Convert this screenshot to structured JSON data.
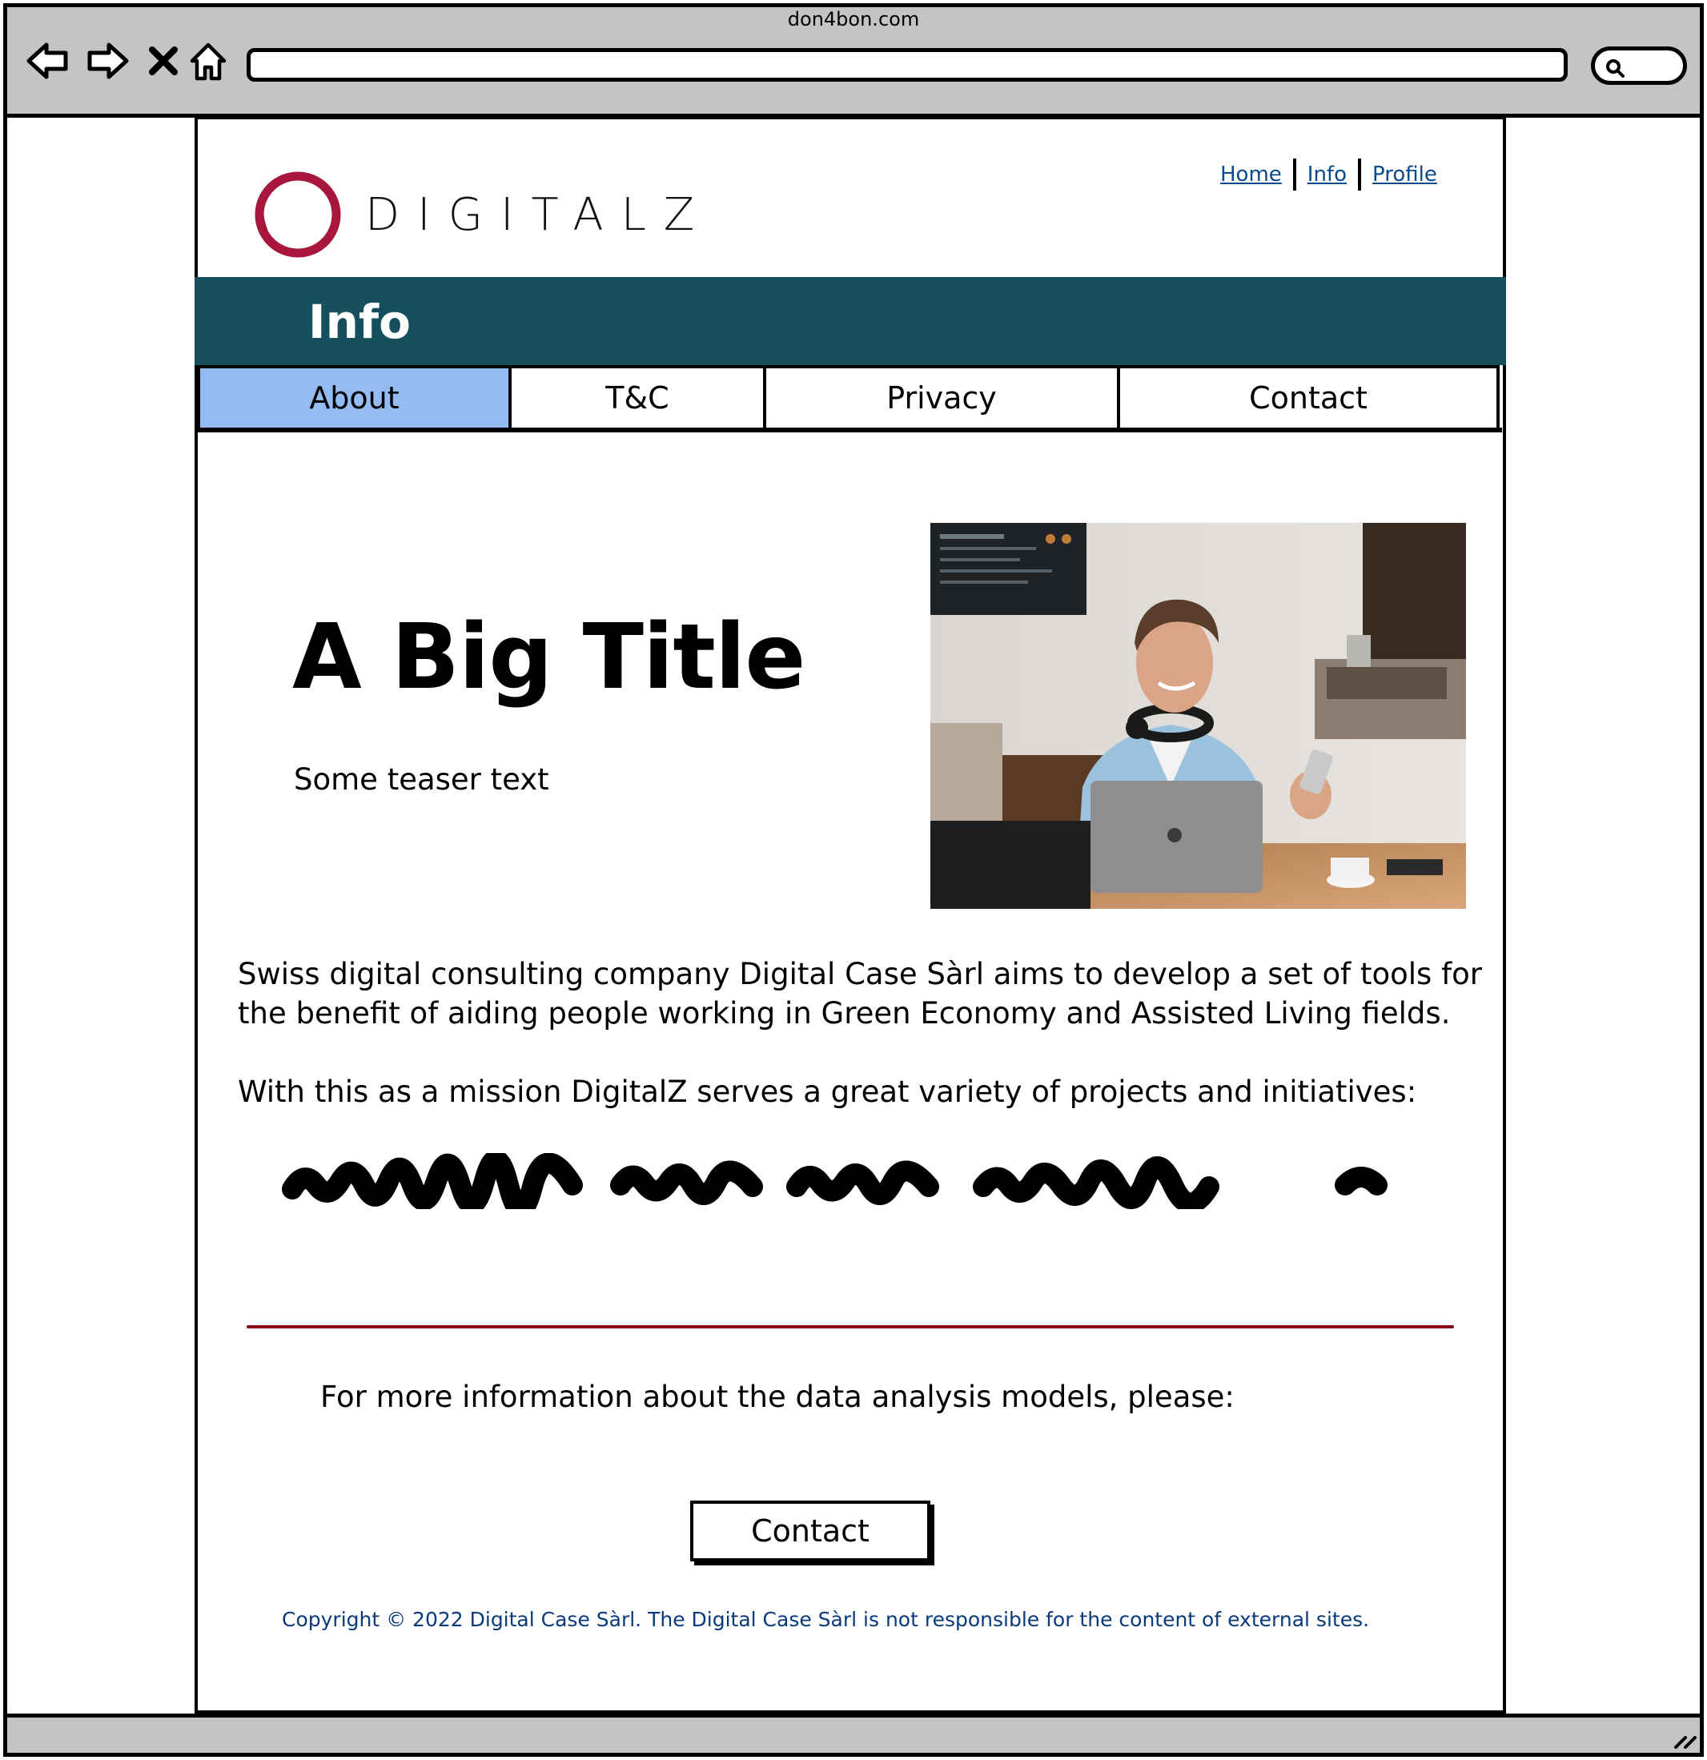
{
  "browser": {
    "url": "don4bon.com",
    "nav_icons": [
      "back-icon",
      "forward-icon",
      "close-icon",
      "home-icon"
    ],
    "search_icon": "magnifier-icon"
  },
  "site": {
    "logo_text": "DIGITALZ",
    "logo_color": "#a8163e",
    "top_links": [
      "Home",
      "Info",
      "Profile"
    ]
  },
  "banner": {
    "title": "Info",
    "color": "#16505f"
  },
  "tabs": [
    {
      "label": "About",
      "active": true
    },
    {
      "label": "T&C",
      "active": false
    },
    {
      "label": "Privacy",
      "active": false
    },
    {
      "label": "Contact",
      "active": false
    }
  ],
  "hero": {
    "title": "A Big Title",
    "teaser": "Some teaser text"
  },
  "body": {
    "paragraph1": "Swiss digital consulting company Digital Case Sàrl aims to develop a set of tools for the benefit of aiding people working in Green Economy and Assisted Living fields.",
    "paragraph2": "With this as a mission DigitalZ serves a great variety of projects and initiatives:"
  },
  "cta": {
    "text": "For more information about the data analysis models, please:",
    "button_label": "Contact"
  },
  "footer": {
    "copyright": "Copyright © 2022 Digital Case Sàrl. The Digital Case Sàrl is not responsible for the content of external sites."
  },
  "colors": {
    "active_tab": "#95bcf2",
    "link": "#0a4a8a",
    "divider": "#8a0a1a",
    "chrome": "#c4c4c4"
  }
}
